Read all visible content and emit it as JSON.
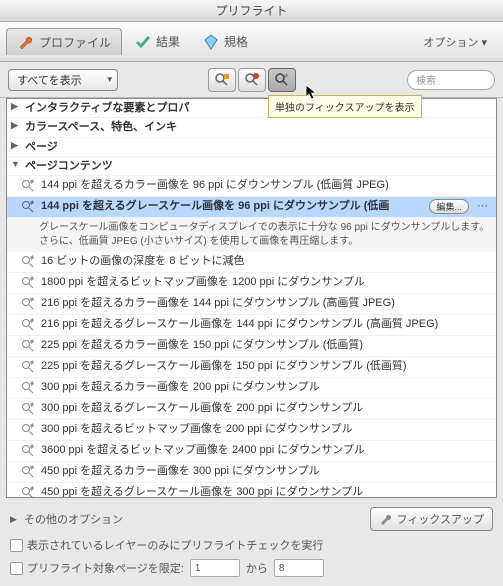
{
  "title": "プリフライト",
  "tabs": {
    "profile": "プロファイル",
    "result": "結果",
    "standard": "規格"
  },
  "option_btn": "オプション",
  "dropdown": {
    "value": "すべてを表示"
  },
  "search_placeholder": "検索",
  "tooltip": "単独のフィックスアップを表示",
  "headers": {
    "h0": "インタラクティブな要素とプロパ",
    "h1": "カラースペース、特色、インキ",
    "h2": "ページ",
    "h3": "ページコンテンツ"
  },
  "items": [
    "144 ppi を超えるカラー画像を 96 ppi にダウンサンプル (低画質 JPEG)",
    "144 ppi を超えるグレースケール画像を 96 ppi にダウンサンプル (低画",
    "16 ビットの画像の深度を 8 ビットに減色",
    "1800 ppi を超えるビットマップ画像を 1200 ppi にダウンサンプル",
    "216 ppi を超えるカラー画像を 144 ppi にダウンサンプル (高画質 JPEG)",
    "216 ppi を超えるグレースケール画像を 144 ppi にダウンサンプル (高画質 JPEG)",
    "225 ppi を超えるカラー画像を 150 ppi にダウンサンプル (低画質)",
    "225 ppi を超えるグレースケール画像を 150 ppi にダウンサンプル (低画質)",
    "300 ppi を超えるカラー画像を 200 ppi にダウンサンプル",
    "300 ppi を超えるグレースケール画像を 200 ppi にダウンサンプル",
    "300 ppi を超えるビットマップ画像を 200 ppi にダウンサンプル",
    "3600 ppi を超えるビットマップ画像を 2400 ppi にダウンサンプル",
    "450 ppi を超えるカラー画像を 300 ppi にダウンサンプル",
    "450 ppi を超えるグレースケール画像を 300 ppi にダウンサンプル"
  ],
  "description": "グレースケール画像をコンピュータディスプレイでの表示に十分な 96 ppi にダウンサンプルします。さらに、低画質 JPEG (小さいサイズ) を使用して画像を再圧縮します。",
  "edit_label": "編集...",
  "footer": {
    "other_options": "その他のオプション",
    "fixup_btn": "フィックスアップ",
    "check_layers": "表示されているレイヤーのみにプリフライトチェックを実行",
    "limit_pages": "プリフライト対象ページを限定:",
    "from_page": "1",
    "to_label": "から",
    "to_page": "8"
  }
}
